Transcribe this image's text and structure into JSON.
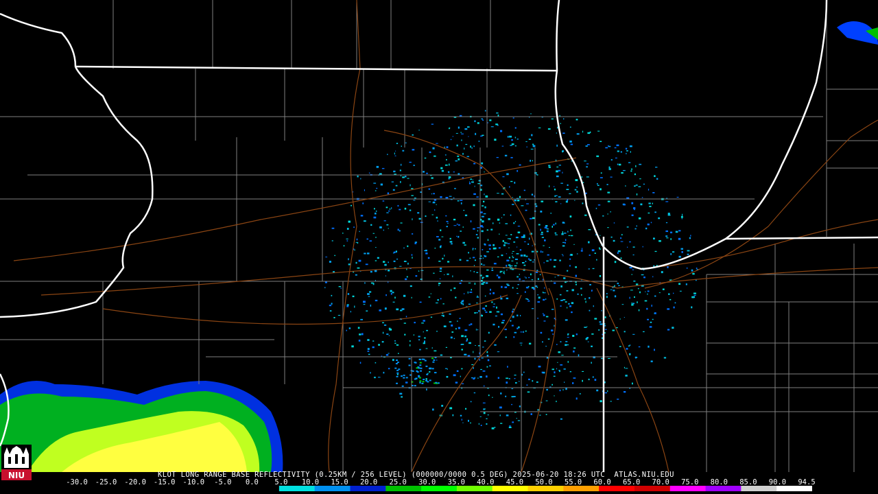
{
  "header": {
    "status_line": "KLOT LONG RANGE BASE REFLECTIVITY (0.25KM / 256 LEVEL) (000000/0000 0.5 DEG) 2025-06-20 18:26 UTC  ATLAS.NIU.EDU"
  },
  "logo": {
    "text": "NIU",
    "color": "#c8102e"
  },
  "legend": {
    "ticks": [
      "-30.0",
      "-25.0",
      "-20.0",
      "-15.0",
      "-10.0",
      "-5.0",
      "0.0",
      "5.0",
      "10.0",
      "15.0",
      "20.0",
      "25.0",
      "30.0",
      "35.0",
      "40.0",
      "45.0",
      "50.0",
      "55.0",
      "60.0",
      "65.0",
      "70.0",
      "75.0",
      "80.0",
      "85.0",
      "90.0",
      "94.5"
    ],
    "colors": [
      "#000000",
      "#000000",
      "#000000",
      "#000000",
      "#000000",
      "#000000",
      "#00e0e0",
      "#0090f0",
      "#0020d0",
      "#00c000",
      "#00ff00",
      "#70ff00",
      "#ffff00",
      "#ffd000",
      "#ffa000",
      "#ff0000",
      "#d00000",
      "#ff00ff",
      "#a000ff",
      "#d0d0d0",
      "#ffffff"
    ]
  },
  "map": {
    "colors": {
      "background": "#000000",
      "state_border": "#ffffff",
      "county_border": "#808080",
      "road": "#8b4513",
      "echo_light": "#00c0e0",
      "echo_mid": "#0050ff",
      "echo_green": "#00d000",
      "echo_yellow": "#ffff40"
    }
  }
}
